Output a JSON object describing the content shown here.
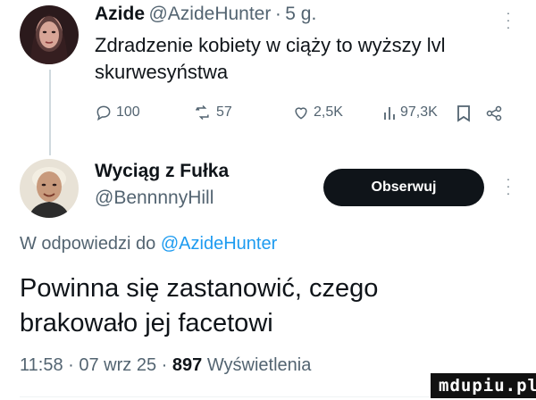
{
  "tweet": {
    "author_name": "Azide",
    "author_handle": "@AzideHunter",
    "separator": "·",
    "time": "5 g.",
    "text_line1": "Zdradzenie kobiety w ciąży to wyższy lvl",
    "text_line2": "skurwesyństwa",
    "actions": {
      "replies": "100",
      "retweets": "57",
      "likes": "2,5K",
      "views": "97,3K"
    }
  },
  "reply": {
    "author_name": "Wyciąg z Fułka",
    "author_handle": "@BennnnyHill",
    "follow_label": "Obserwuj",
    "reply_to_prefix": "W odpowiedzi do",
    "reply_to_handle": "@AzideHunter",
    "text_line1": "Powinna się zastanowić, czego",
    "text_line2": "brakowało jej facetowi",
    "time": "11:58",
    "date": "07 wrz 25",
    "views_count": "897",
    "views_label": "Wyświetlenia"
  },
  "watermark": "mdupiu.pl",
  "colors": {
    "accent": "#1d9bf0",
    "text": "#0f1419",
    "muted": "#536471",
    "button": "#0f1419"
  }
}
